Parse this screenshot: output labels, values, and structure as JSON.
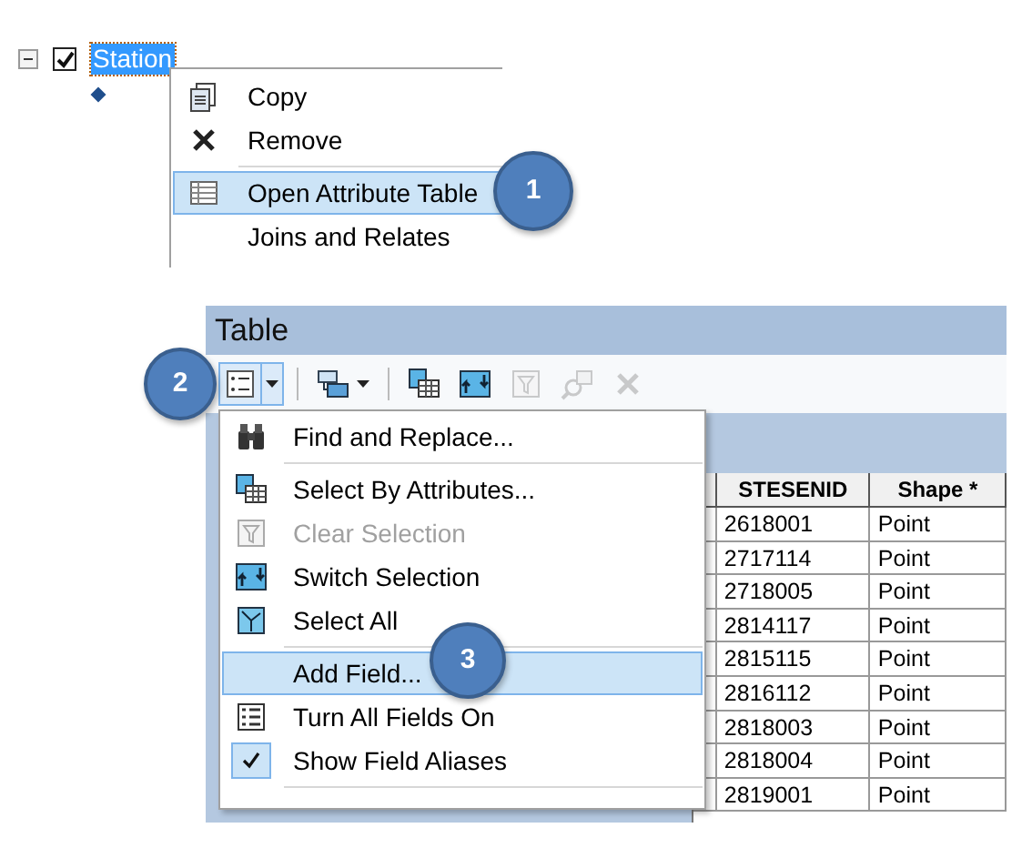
{
  "layer_tree": {
    "layer": {
      "name": "Station",
      "expanded": true,
      "checked": true,
      "selected": true
    }
  },
  "context_menu": {
    "items": [
      {
        "kind": "item",
        "label": "Copy",
        "highlighted": false
      },
      {
        "kind": "item",
        "label": "Remove",
        "highlighted": false
      },
      {
        "kind": "separator"
      },
      {
        "kind": "item",
        "label": "Open Attribute Table",
        "highlighted": true
      },
      {
        "kind": "item",
        "label": "Joins and Relates",
        "highlighted": false
      }
    ]
  },
  "table_window": {
    "title": "Table",
    "toolbar": [
      {
        "kind": "button",
        "dropdown": true,
        "pressed": true,
        "disabled": false
      },
      {
        "kind": "separator"
      },
      {
        "kind": "button",
        "dropdown": true,
        "pressed": false,
        "disabled": false
      },
      {
        "kind": "separator"
      },
      {
        "kind": "button",
        "dropdown": false,
        "pressed": false,
        "disabled": false
      },
      {
        "kind": "button",
        "dropdown": false,
        "pressed": false,
        "disabled": false
      },
      {
        "kind": "button",
        "dropdown": false,
        "pressed": false,
        "disabled": true
      },
      {
        "kind": "button",
        "dropdown": false,
        "pressed": false,
        "disabled": true
      },
      {
        "kind": "button",
        "dropdown": false,
        "pressed": false,
        "disabled": true
      }
    ],
    "table": {
      "columns": [
        {
          "name": "STESENID"
        },
        {
          "name": "Shape *"
        }
      ],
      "rows": [
        {
          "stesenid": "2618001",
          "shape": "Point"
        },
        {
          "stesenid": "2717114",
          "shape": "Point"
        },
        {
          "stesenid": "2718005",
          "shape": "Point"
        },
        {
          "stesenid": "2814117",
          "shape": "Point"
        },
        {
          "stesenid": "2815115",
          "shape": "Point"
        },
        {
          "stesenid": "2816112",
          "shape": "Point"
        },
        {
          "stesenid": "2818003",
          "shape": "Point"
        },
        {
          "stesenid": "2818004",
          "shape": "Point"
        },
        {
          "stesenid": "2819001",
          "shape": "Point"
        }
      ]
    },
    "options_menu": {
      "items": [
        {
          "kind": "item",
          "label": "Find and Replace...",
          "disabled": false,
          "highlighted": false,
          "checked": false
        },
        {
          "kind": "separator"
        },
        {
          "kind": "item",
          "label": "Select By Attributes...",
          "disabled": false,
          "highlighted": false,
          "checked": false
        },
        {
          "kind": "item",
          "label": "Clear Selection",
          "disabled": true,
          "highlighted": false,
          "checked": false
        },
        {
          "kind": "item",
          "label": "Switch Selection",
          "disabled": false,
          "highlighted": false,
          "checked": false
        },
        {
          "kind": "item",
          "label": "Select All",
          "disabled": false,
          "highlighted": false,
          "checked": false
        },
        {
          "kind": "separator"
        },
        {
          "kind": "item",
          "label": "Add Field...",
          "disabled": false,
          "highlighted": true,
          "checked": false
        },
        {
          "kind": "item",
          "label": "Turn All Fields On",
          "disabled": false,
          "highlighted": false,
          "checked": false
        },
        {
          "kind": "item",
          "label": "Show Field Aliases",
          "disabled": false,
          "highlighted": false,
          "checked": true
        },
        {
          "kind": "separator"
        }
      ]
    }
  },
  "callouts": [
    {
      "number": "1"
    },
    {
      "number": "2"
    },
    {
      "number": "3"
    }
  ]
}
